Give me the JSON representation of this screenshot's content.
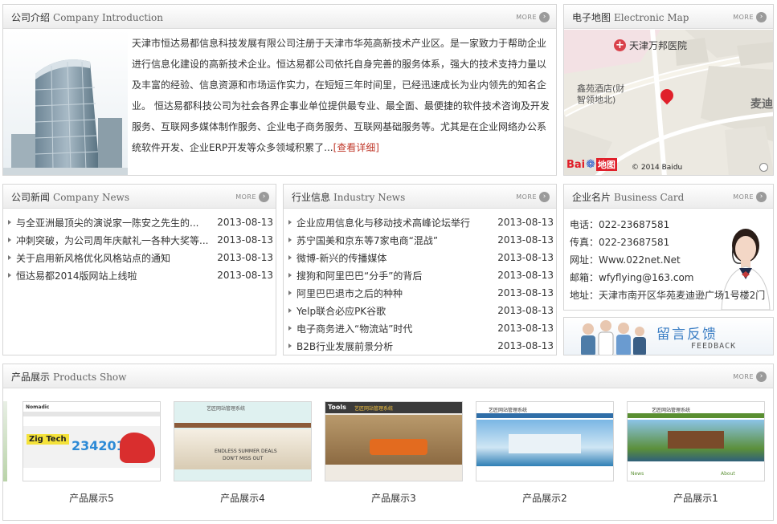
{
  "intro": {
    "title_cn": "公司介绍",
    "title_en": "Company Introduction",
    "more": "MORE",
    "text": "天津市恒达易都信息科技发展有限公司注册于天津市华苑高新技术产业区。是一家致力于帮助企业进行信息化建设的高新技术企业。恒达易都公司依托自身完善的服务体系，强大的技术支持力量以及丰富的经验、信息资源和市场运作实力，在短短三年时间里，已经迅速成长为业内领先的知名企业。 恒达易都科技公司为社会各界企事业单位提供最专业、最全面、最便捷的软件技术咨询及开发服务、互联网多媒体制作服务、企业电子商务服务、互联网基础服务等。尤其是在企业网络办公系统软件开发、企业ERP开发等众多领域积累了...",
    "detail_link": "[查看详细]"
  },
  "map": {
    "title_cn": "电子地图",
    "title_en": "Electronic Map",
    "more": "MORE",
    "hospital": "天津万邦医院",
    "hotel_line1": "鑫苑酒店(财",
    "hotel_line2": "智领地北)",
    "road": "麦迪",
    "logo_bai": "Bai",
    "logo_map": "地图",
    "copyright": "© 2014 Baidu"
  },
  "news": {
    "title_cn": "公司新闻",
    "title_en": "Company News",
    "more": "MORE",
    "items": [
      {
        "title": "与全亚洲最顶尖的演说家一陈安之先生的...",
        "date": "2013-08-13"
      },
      {
        "title": "冲刺突破，为公司周年庆献礼一各种大奖等...",
        "date": "2013-08-13"
      },
      {
        "title": "关于启用新风格优化风格站点的通知",
        "date": "2013-08-13"
      },
      {
        "title": "恒达易都2014版网站上线啦",
        "date": "2013-08-13"
      }
    ]
  },
  "industry": {
    "title_cn": "行业信息",
    "title_en": "Industry News",
    "more": "MORE",
    "items": [
      {
        "title": "企业应用信息化与移动技术高峰论坛举行",
        "date": "2013-08-13"
      },
      {
        "title": "苏宁国美和京东等7家电商“混战”",
        "date": "2013-08-13"
      },
      {
        "title": "微博-新兴的传播媒体",
        "date": "2013-08-13"
      },
      {
        "title": "搜狗和阿里巴巴“分手”的背后",
        "date": "2013-08-13"
      },
      {
        "title": "阿里巴巴退市之后的种种",
        "date": "2013-08-13"
      },
      {
        "title": "Yelp联合必应PK谷歌",
        "date": "2013-08-13"
      },
      {
        "title": "电子商务进入“物流站”时代",
        "date": "2013-08-13"
      },
      {
        "title": "B2B行业发展前景分析",
        "date": "2013-08-13"
      }
    ]
  },
  "card": {
    "title_cn": "企业名片",
    "title_en": "Business Card",
    "more": "MORE",
    "lines": [
      "电话：022-23687581",
      "传真：022-23687581",
      "网址：Www.022net.Net",
      "邮箱：wfyflying@163.com",
      "地址：天津市南开区华苑麦迪逊广场1号楼2门"
    ]
  },
  "feedback": {
    "title": "留言反馈",
    "subtitle": "FEEDBACK"
  },
  "products": {
    "title_cn": "产品展示",
    "title_en": "Products Show",
    "more": "MORE",
    "items": [
      {
        "label": "产品展示5",
        "thumb_text": "Zig Tech",
        "thumb_number": "2342017",
        "site_name": "Nomadic"
      },
      {
        "label": "产品展示4",
        "thumb_text": "ENDLESS SUMMER DEALS",
        "thumb_sub": "DON'T MISS OUT",
        "site_name": "艺匠网站管理系统"
      },
      {
        "label": "产品展示3",
        "thumb_text": "Tools",
        "site_name": "艺匠网站管理系统"
      },
      {
        "label": "产品展示2",
        "site_name": "艺匠网站管理系统"
      },
      {
        "label": "产品展示1",
        "site_name": "艺匠网站管理系统",
        "thumb_text": "News",
        "thumb_sub": "About"
      }
    ]
  },
  "colors": {
    "accent_red": "#c0392b",
    "feedback_blue": "#3b7ec4"
  }
}
